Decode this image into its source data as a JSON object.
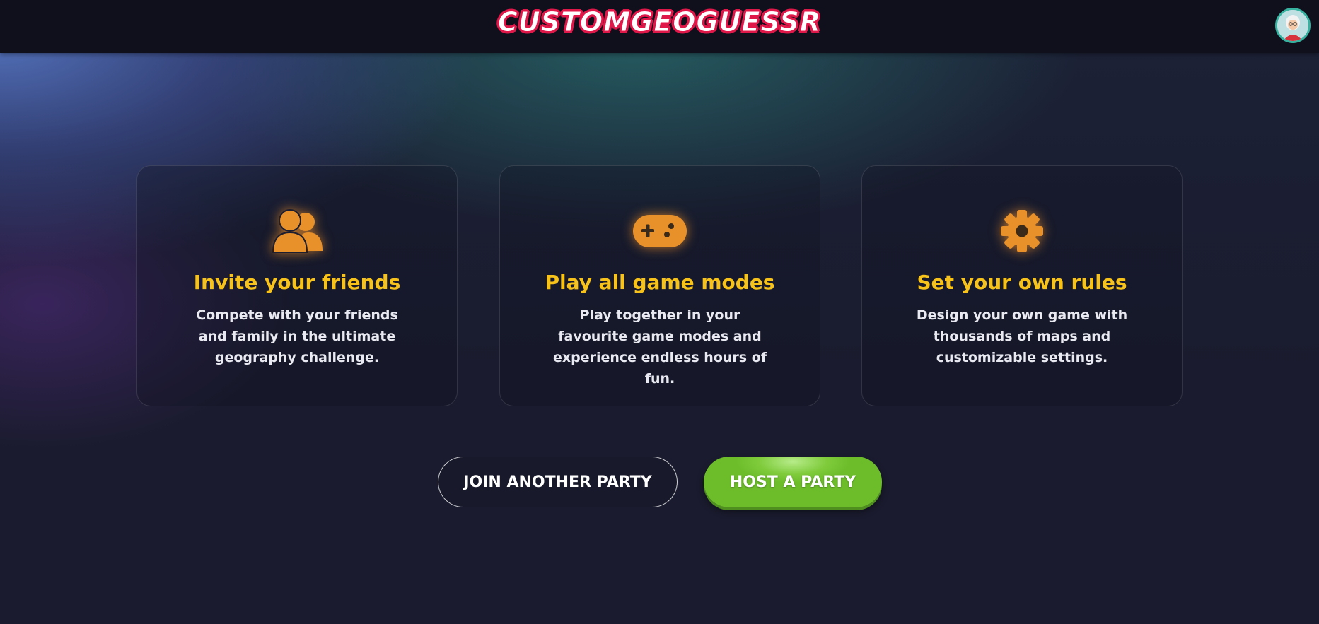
{
  "header": {
    "logo_text": "CUSTOMGEOGUESSR",
    "avatar_icon": "user-avatar"
  },
  "features": [
    {
      "icon": "users-icon",
      "title": "Invite your friends",
      "description": "Compete with your friends and family in the ultimate geography challenge."
    },
    {
      "icon": "gamepad-icon",
      "title": "Play all game modes",
      "description": "Play together in your favourite game modes and experience endless hours of fun."
    },
    {
      "icon": "gear-icon",
      "title": "Set your own rules",
      "description": "Design your own game with thousands of maps and customizable settings."
    }
  ],
  "actions": {
    "join_label": "JOIN ANOTHER PARTY",
    "host_label": "HOST A PARTY"
  },
  "colors": {
    "accent": "#f7c31b",
    "icon": "#e8912a",
    "host_button": "#7fcb3c",
    "logo_stroke": "#e0184a"
  }
}
